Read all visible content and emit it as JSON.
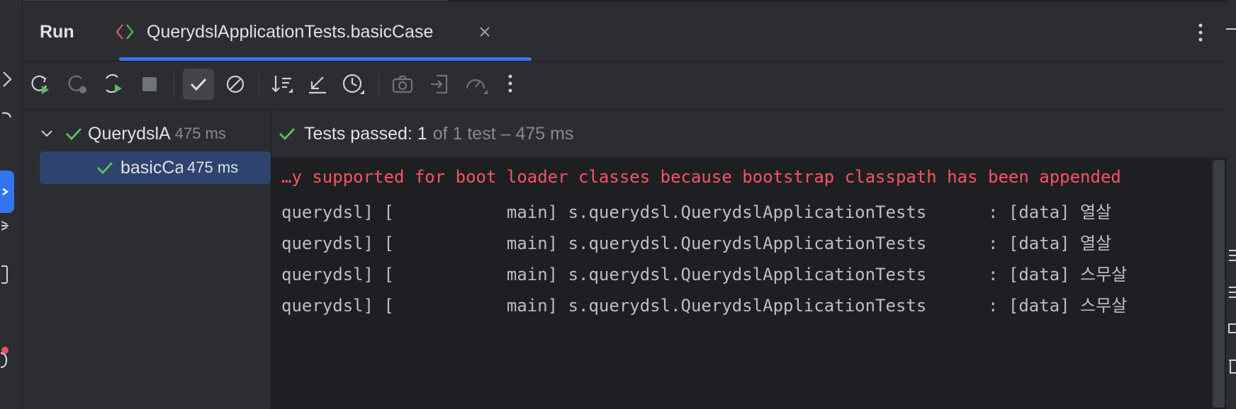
{
  "panel": {
    "title": "Run"
  },
  "tab": {
    "label": "QuerydslApplicationTests.basicCase",
    "icon": "run-config-icon",
    "close_icon": "close-icon"
  },
  "toolbar": {
    "buttons": [
      {
        "name": "rerun-button",
        "icon": "rerun-icon"
      },
      {
        "name": "rerun-failed-button",
        "icon": "rerun-failed-icon",
        "disabled": true
      },
      {
        "name": "toggle-auto-test-button",
        "icon": "auto-test-icon"
      },
      {
        "name": "stop-button",
        "icon": "stop-icon",
        "disabled": true
      },
      {
        "name": "show-passed-button",
        "icon": "check-icon",
        "toggled": true
      },
      {
        "name": "show-ignored-button",
        "icon": "ignored-icon"
      },
      {
        "name": "sort-button",
        "icon": "sort-icon"
      },
      {
        "name": "collapse-button",
        "icon": "collapse-icon"
      },
      {
        "name": "history-button",
        "icon": "history-icon"
      },
      {
        "name": "screenshot-button",
        "icon": "camera-icon",
        "disabled": true
      },
      {
        "name": "import-button",
        "icon": "import-icon",
        "disabled": true
      },
      {
        "name": "profile-button",
        "icon": "speedometer-icon",
        "disabled": true
      },
      {
        "name": "more-button",
        "icon": "more-vertical-icon"
      }
    ]
  },
  "tree": {
    "root": {
      "name": "QuerydslA",
      "time": "475 ms",
      "status": "passed"
    },
    "child": {
      "name": "basicCa",
      "time": "475 ms",
      "status": "passed"
    }
  },
  "status": {
    "passed": "Tests passed: 1",
    "rest": "of 1 test – 475 ms"
  },
  "console": {
    "lines": [
      {
        "text": "…y supported for boot loader classes because bootstrap classpath has been appended",
        "kind": "error"
      },
      {
        "text": "querydsl] [           main] s.querydsl.QuerydslApplicationTests      : [data] 열살",
        "kind": "info"
      },
      {
        "text": "querydsl] [           main] s.querydsl.QuerydslApplicationTests      : [data] 열살",
        "kind": "info"
      },
      {
        "text": "querydsl] [           main] s.querydsl.QuerydslApplicationTests      : [data] 스무살",
        "kind": "info"
      },
      {
        "text": "querydsl] [           main] s.querydsl.QuerydslApplicationTests      : [data] 스무살",
        "kind": "info"
      }
    ]
  },
  "colors": {
    "accent": "#3574f0",
    "passed": "#5fb865",
    "error_text": "#f75464",
    "selection": "#2e436e"
  }
}
